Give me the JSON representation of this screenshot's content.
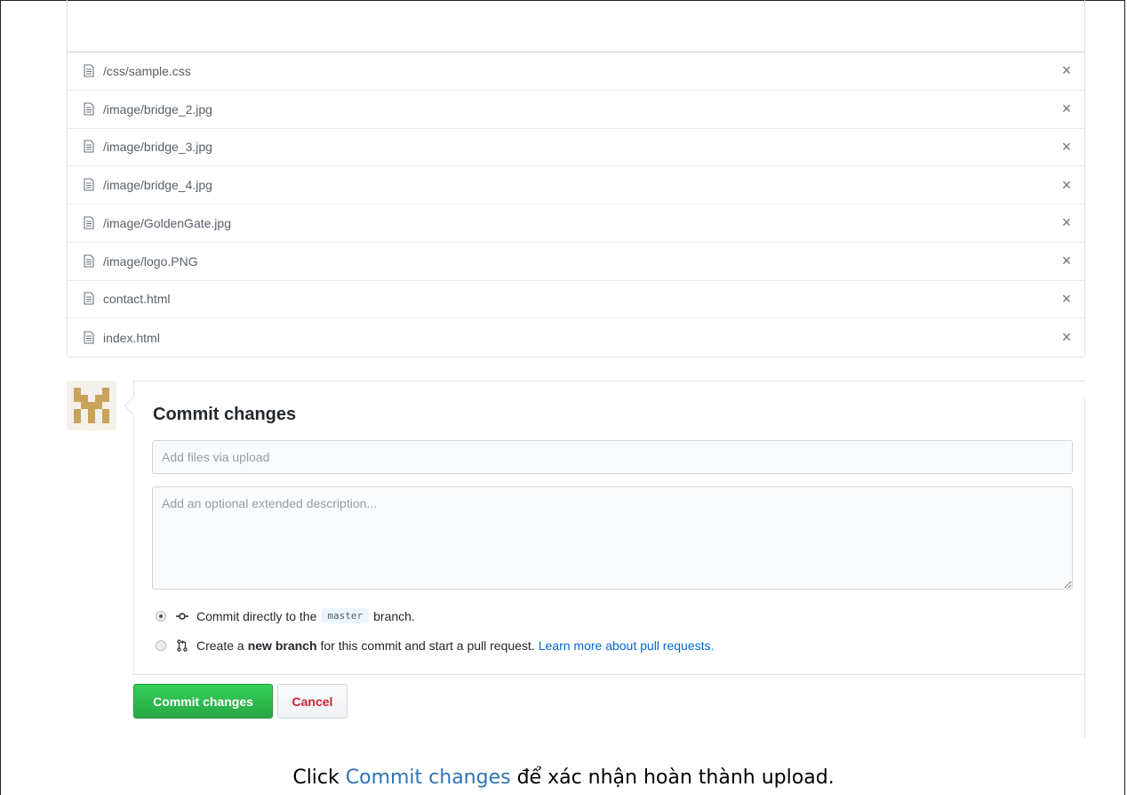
{
  "files": [
    "/css/sample.css",
    "/image/bridge_2.jpg",
    "/image/bridge_3.jpg",
    "/image/bridge_4.jpg",
    "/image/GoldenGate.jpg",
    "/image/logo.PNG",
    "contact.html",
    "index.html"
  ],
  "remove_glyph": "×",
  "commit": {
    "title": "Commit changes",
    "summary_placeholder": "Add files via upload",
    "description_placeholder": "Add an optional extended description...",
    "option_direct": {
      "prefix": "Commit directly to the",
      "branch": "master",
      "suffix": "branch.",
      "selected": true,
      "icon": "git-commit-icon"
    },
    "option_new_branch": {
      "prefix": "Create a",
      "bold": "new branch",
      "suffix": "for this commit and start a pull request.",
      "link": "Learn more about pull requests.",
      "selected": false,
      "icon": "git-pull-request-icon"
    },
    "submit_label": "Commit changes",
    "cancel_label": "Cancel"
  },
  "caption": {
    "prefix": "Click ",
    "highlight": "Commit changes",
    "suffix": " để xác nhận hoàn thành upload."
  },
  "colors": {
    "primary_green": "#28a745",
    "cancel_red": "#cb2431",
    "link_blue": "#0366d6",
    "caption_highlight": "#2e75b6"
  }
}
